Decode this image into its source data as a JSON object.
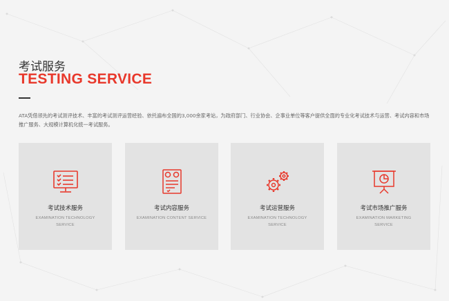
{
  "section": {
    "title_cn": "考试服务",
    "title_en": "TESTING SERVICE",
    "intro": "ATA凭借领先的考试测评技术、丰富的考试测评运营经验、依托遍布全国的3,000余家考站，为政府部门、行业协会、企事业单位等客户提供全面的专业化考试技术与运营、考试内容和市场推广服务、大规模计算机化统一考试服务。"
  },
  "colors": {
    "accent": "#e8382b",
    "card_bg": "#e3e3e3",
    "page_bg": "#f4f4f4"
  },
  "services": [
    {
      "icon": "monitor-checklist-icon",
      "name": "考试技术服务",
      "name_en": "EXAMINATION TECHNOLOGY SERVICE"
    },
    {
      "icon": "answer-sheet-icon",
      "name": "考试内容服务",
      "name_en": "EXAMINATION CONTENT SERVICE"
    },
    {
      "icon": "gears-icon",
      "name": "考试运营服务",
      "name_en": "EXAMINATION TECHNOLOGY SERVICE"
    },
    {
      "icon": "presentation-chart-icon",
      "name": "考试市场推广服务",
      "name_en": "EXAMINATION MARKETING SERVICE"
    }
  ]
}
